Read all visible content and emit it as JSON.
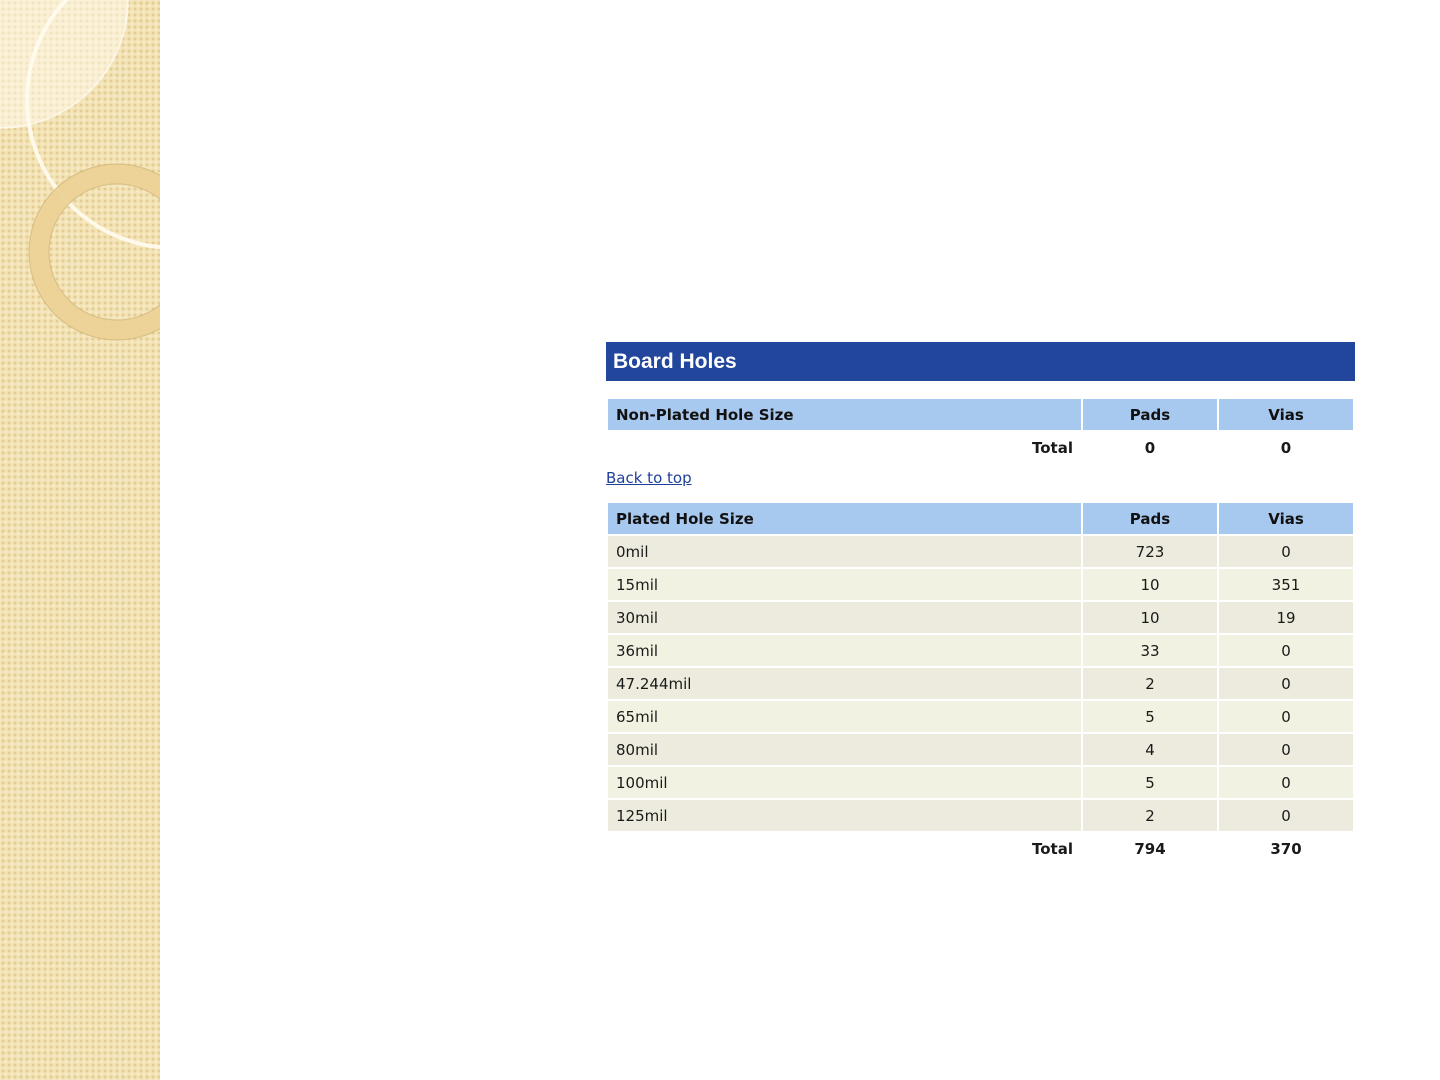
{
  "section": {
    "title": "Board Holes"
  },
  "non_plated": {
    "headers": [
      "Non-Plated Hole Size",
      "Pads",
      "Vias"
    ],
    "rows": [],
    "total": {
      "label": "Total",
      "pads": "0",
      "vias": "0"
    }
  },
  "back_link": {
    "label": "Back to top"
  },
  "plated": {
    "headers": [
      "Plated Hole Size",
      "Pads",
      "Vias"
    ],
    "rows": [
      {
        "size": "0mil",
        "pads": "723",
        "vias": "0"
      },
      {
        "size": "15mil",
        "pads": "10",
        "vias": "351"
      },
      {
        "size": "30mil",
        "pads": "10",
        "vias": "19"
      },
      {
        "size": "36mil",
        "pads": "33",
        "vias": "0"
      },
      {
        "size": "47.244mil",
        "pads": "2",
        "vias": "0"
      },
      {
        "size": "65mil",
        "pads": "5",
        "vias": "0"
      },
      {
        "size": "80mil",
        "pads": "4",
        "vias": "0"
      },
      {
        "size": "100mil",
        "pads": "5",
        "vias": "0"
      },
      {
        "size": "125mil",
        "pads": "2",
        "vias": "0"
      }
    ],
    "total": {
      "label": "Total",
      "pads": "794",
      "vias": "370"
    }
  },
  "colors": {
    "header_bar": "#21469c",
    "column_header": "#a8c9ef",
    "row_odd": "#ecebde",
    "row_even": "#f2f2e2",
    "link": "#1f3f9a",
    "side_strip": "#f3e2b4"
  }
}
